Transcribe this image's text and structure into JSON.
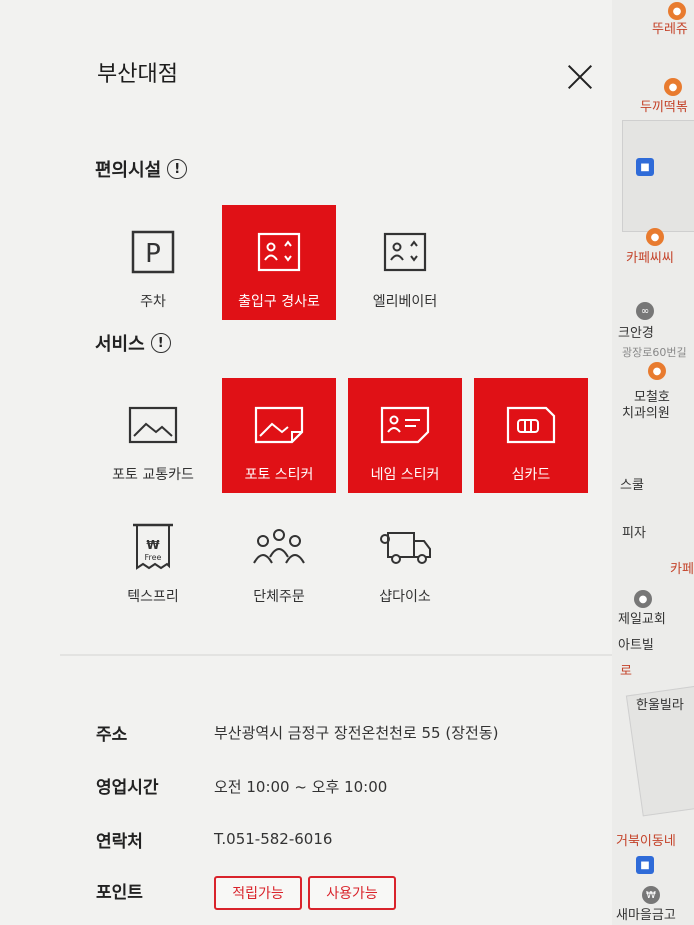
{
  "store": {
    "title": "부산대점"
  },
  "facilities": {
    "title": "편의시설",
    "items": [
      {
        "label": "주차",
        "active": false,
        "icon": "parking-icon"
      },
      {
        "label": "출입구 경사로",
        "active": true,
        "icon": "ramp-icon"
      },
      {
        "label": "엘리베이터",
        "active": false,
        "icon": "elevator-icon"
      }
    ]
  },
  "services": {
    "title": "서비스",
    "items": [
      {
        "label": "포토 교통카드",
        "active": false,
        "icon": "photo-card-icon"
      },
      {
        "label": "포토 스티커",
        "active": true,
        "icon": "photo-sticker-icon"
      },
      {
        "label": "네임 스티커",
        "active": true,
        "icon": "name-sticker-icon"
      },
      {
        "label": "심카드",
        "active": true,
        "icon": "sim-card-icon"
      },
      {
        "label": "텍스프리",
        "active": false,
        "icon": "tax-free-icon"
      },
      {
        "label": "단체주문",
        "active": false,
        "icon": "group-order-icon"
      },
      {
        "label": "샵다이소",
        "active": false,
        "icon": "delivery-truck-icon"
      }
    ],
    "taxfree_badge": "₩",
    "taxfree_word": "Free"
  },
  "details": {
    "address_label": "주소",
    "address_value": "부산광역시 금정구 장전온천천로 55 (장전동)",
    "hours_label": "영업시간",
    "hours_value": "오전 10:00 ~ 오후 10:00",
    "contact_label": "연락처",
    "contact_value": "T.051-582-6016",
    "points_label": "포인트",
    "points_buttons": [
      "적립가능",
      "사용가능"
    ]
  },
  "map": {
    "labels": [
      "뚜레쥬",
      "두끼떡볶",
      "카페씨씨",
      "크안경",
      "광장로60번길",
      "모철호",
      "치과의원",
      "스쿨",
      "피자",
      "카페",
      "제일교회",
      "아트빌",
      "로",
      "한울빌라",
      "거북이동네",
      "새마을금고"
    ]
  },
  "colors": {
    "accent": "#e01116",
    "panel_bg": "#f2f2f0"
  }
}
